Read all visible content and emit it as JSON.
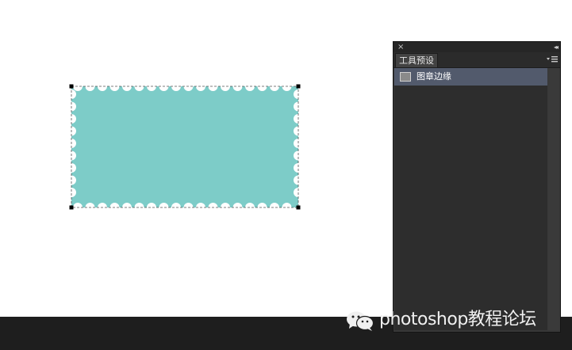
{
  "canvas": {
    "shape_color": "#7dccc8",
    "background": "#ffffff"
  },
  "panel": {
    "tab_label": "工具预设",
    "close_glyph": "×",
    "collapse_glyph": "◂◂",
    "presets": [
      {
        "label": "图章边缘",
        "selected": true
      }
    ]
  },
  "watermark": {
    "text": "photoshop教程论坛",
    "icon": "wechat-icon"
  }
}
